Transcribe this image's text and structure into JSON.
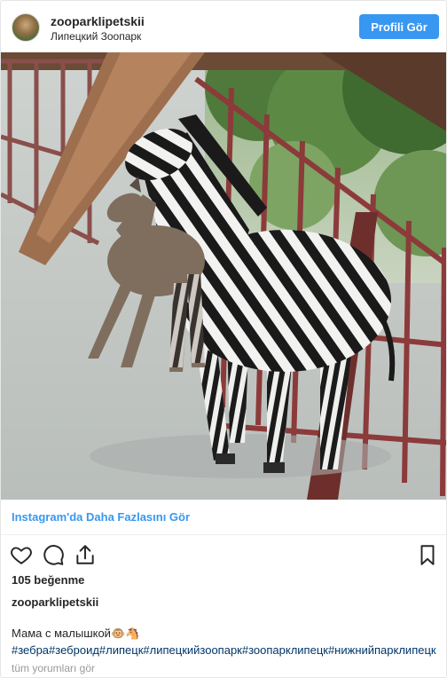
{
  "header": {
    "username": "zooparklipetskii",
    "location": "Липецкий Зоопарк",
    "profile_button": "Profili Gör"
  },
  "photo": {
    "subject": "zebra with zebroid foal",
    "icon": "post-photo"
  },
  "more_link": "Instagram'da Daha Fazlasını Gör",
  "actions": {
    "icons": [
      "heart-icon",
      "comment-icon",
      "share-icon",
      "bookmark-icon"
    ]
  },
  "likes": "105 beğenme",
  "caption": {
    "username": "zooparklipetskii",
    "text": "Мама с малышкой🐵🐴",
    "hashtags": "#зебра#зеброид#липецк#липецкийзоопарк#зоопарклипецк#нижнийпарклипецк"
  },
  "comments_link": "tüm yorumları gör",
  "colors": {
    "accent": "#3897f0",
    "hashtag": "#003569",
    "muted": "#999999",
    "text": "#262626"
  }
}
